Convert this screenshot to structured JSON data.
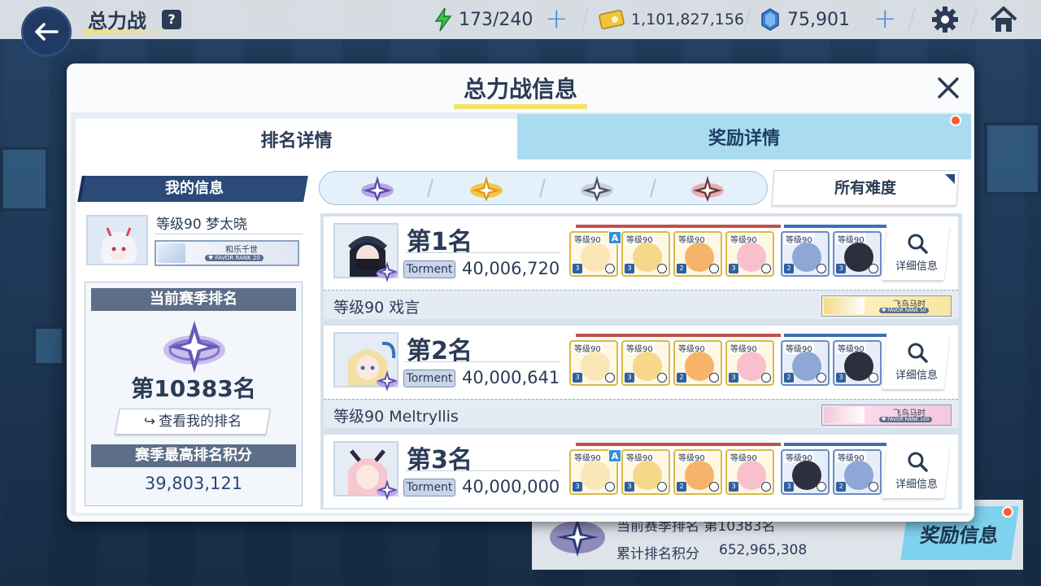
{
  "topbar": {
    "title": "总力战",
    "help_label": "?",
    "ap": "173/240",
    "credits": "1,101,827,156",
    "pyroxene": "75,901"
  },
  "behind": {
    "text1": "当前赛季排名  第10383名",
    "cumulative_label": "累计排名积分",
    "cumulative_value": "652,965,308",
    "reward_info_button": "奖励信息"
  },
  "modal": {
    "title": "总力战信息",
    "tabs": {
      "ranking": "排名详情",
      "rewards": "奖励详情"
    }
  },
  "my_info": {
    "header": "我的信息",
    "name": "等级90 梦太晓",
    "card_name": "和乐千世",
    "card_rank": "♥ FAVOR RANK 20",
    "season_rank_header": "当前赛季排名",
    "season_rank": "第10383名",
    "view_my_rank_button": "查看我的排名",
    "best_score_header": "赛季最高排名积分",
    "best_score": "39,803,121"
  },
  "filter": {
    "difficulty_selected": "所有难度"
  },
  "entries": [
    {
      "rank": "第1名",
      "difficulty": "Torment",
      "score": "40,006,720",
      "player": "等级90 戏言",
      "card_name": "飞鸟马时",
      "card_rank": "♥ FAVOR RANK 50",
      "detail_label": "详细信息",
      "student_levels": [
        "等级90",
        "等级90",
        "等级90",
        "等级90",
        "等级90",
        "等级90"
      ],
      "student_stars": [
        "3",
        "3",
        "2",
        "3",
        "2",
        "3"
      ],
      "assist_label": "A"
    },
    {
      "rank": "第2名",
      "difficulty": "Torment",
      "score": "40,000,641",
      "player": "等级90 Meltryllis",
      "card_name": "飞鸟马时",
      "card_rank": "♥ FAVOR RANK 100",
      "detail_label": "详细信息",
      "student_levels": [
        "等级90",
        "等级90",
        "等级90",
        "等级90",
        "等级90",
        "等级90"
      ],
      "student_stars": [
        "3",
        "3",
        "2",
        "3",
        "2",
        "3"
      ]
    },
    {
      "rank": "第3名",
      "difficulty": "Torment",
      "score": "40,000,000",
      "detail_label": "详细信息",
      "student_levels": [
        "等级90",
        "等级90",
        "等级90",
        "等级90",
        "等级90",
        "等级90"
      ],
      "student_stars": [
        "3",
        "3",
        "2",
        "3",
        "3",
        "2"
      ],
      "assist_label": "A"
    }
  ],
  "colors": {
    "navy": "#2b3b55",
    "tab_inactive": "#a9dcf0",
    "title_accent": "#f6e46a",
    "notification_dot": "#ff5a2a"
  }
}
